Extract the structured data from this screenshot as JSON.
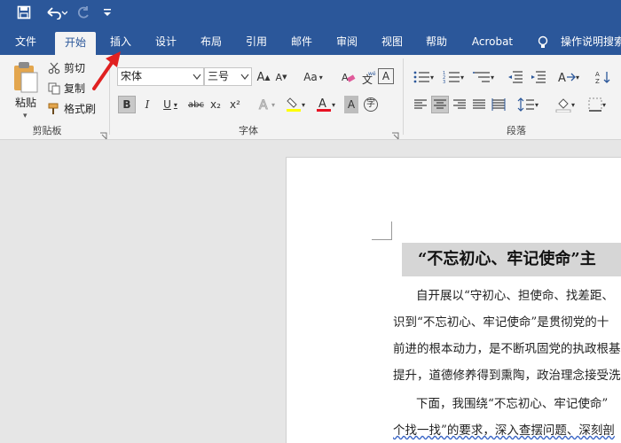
{
  "qat": {
    "save_icon": "save-icon",
    "undo_icon": "undo-icon",
    "redo_icon": "redo-icon",
    "customize_icon": "customize-qat-icon"
  },
  "tabs": [
    {
      "label": "文件"
    },
    {
      "label": "开始"
    },
    {
      "label": "插入"
    },
    {
      "label": "设计"
    },
    {
      "label": "布局"
    },
    {
      "label": "引用"
    },
    {
      "label": "邮件"
    },
    {
      "label": "审阅"
    },
    {
      "label": "视图"
    },
    {
      "label": "帮助"
    },
    {
      "label": "Acrobat"
    },
    {
      "label": "操作说明搜索"
    }
  ],
  "active_tab": "开始",
  "clipboard": {
    "paste_label": "粘贴",
    "cut_label": "剪切",
    "copy_label": "复制",
    "format_painter_label": "格式刷",
    "group_label": "剪贴板"
  },
  "font": {
    "font_name": "宋体",
    "font_size": "三号",
    "group_label": "字体",
    "aa_label": "Aa",
    "bold": "B",
    "italic": "I",
    "underline": "U",
    "strike": "abc",
    "subscript": "x₂",
    "superscript": "x²",
    "char_border": "A",
    "enclose_char": "字"
  },
  "paragraph": {
    "group_label": "段落"
  },
  "document": {
    "title": "“不忘初心、牢记使命”主",
    "lines": [
      "自开展以“守初心、担使命、找差距、",
      "识到“不忘初心、牢记使命”是贯彻党的十",
      "前进的根本动力，是不断巩固党的执政根基",
      "提升，道德修养得到熏陶，政治理念接受洗",
      "下面，我围绕“不忘初心、牢记使命”",
      "个找一找”的要求，深入查摆问题、深刻剖"
    ]
  },
  "colors": {
    "brand": "#2b579a",
    "ribbon_bg": "#f3f3f3",
    "arrow": "#e02020",
    "font_color_red": "#e81123",
    "highlight_yellow": "#ffff00"
  }
}
